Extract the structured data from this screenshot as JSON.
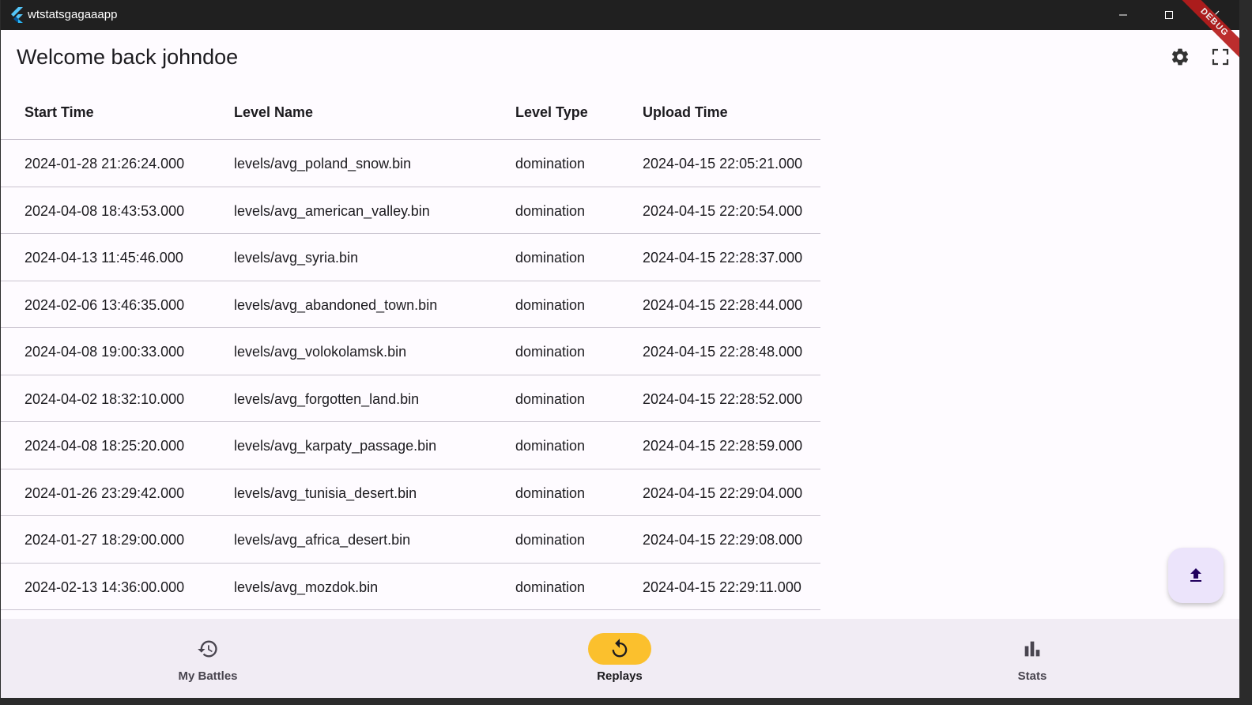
{
  "window": {
    "title": "wtstatsgagaaapp"
  },
  "header": {
    "welcome": "Welcome back johndoe",
    "debug_banner": "DEBUG"
  },
  "table": {
    "columns": [
      "Start Time",
      "Level Name",
      "Level Type",
      "Upload Time"
    ],
    "rows": [
      [
        "2024-01-28 21:26:24.000",
        "levels/avg_poland_snow.bin",
        "domination",
        "2024-04-15 22:05:21.000"
      ],
      [
        "2024-04-08 18:43:53.000",
        "levels/avg_american_valley.bin",
        "domination",
        "2024-04-15 22:20:54.000"
      ],
      [
        "2024-04-13 11:45:46.000",
        "levels/avg_syria.bin",
        "domination",
        "2024-04-15 22:28:37.000"
      ],
      [
        "2024-02-06 13:46:35.000",
        "levels/avg_abandoned_town.bin",
        "domination",
        "2024-04-15 22:28:44.000"
      ],
      [
        "2024-04-08 19:00:33.000",
        "levels/avg_volokolamsk.bin",
        "domination",
        "2024-04-15 22:28:48.000"
      ],
      [
        "2024-04-02 18:32:10.000",
        "levels/avg_forgotten_land.bin",
        "domination",
        "2024-04-15 22:28:52.000"
      ],
      [
        "2024-04-08 18:25:20.000",
        "levels/avg_karpaty_passage.bin",
        "domination",
        "2024-04-15 22:28:59.000"
      ],
      [
        "2024-01-26 23:29:42.000",
        "levels/avg_tunisia_desert.bin",
        "domination",
        "2024-04-15 22:29:04.000"
      ],
      [
        "2024-01-27 18:29:00.000",
        "levels/avg_africa_desert.bin",
        "domination",
        "2024-04-15 22:29:08.000"
      ],
      [
        "2024-02-13 14:36:00.000",
        "levels/avg_mozdok.bin",
        "domination",
        "2024-04-15 22:29:11.000"
      ]
    ]
  },
  "fab": {
    "icon": "upload-icon"
  },
  "nav": {
    "items": [
      {
        "label": "My Battles",
        "icon": "history-icon",
        "active": false
      },
      {
        "label": "Replays",
        "icon": "replay-icon",
        "active": true
      },
      {
        "label": "Stats",
        "icon": "bar-chart-icon",
        "active": false
      }
    ]
  },
  "colors": {
    "accent": "#fbc02d",
    "fab_bg": "#ece4fb",
    "nav_bg": "#f1ecf4",
    "titlebar": "#202020",
    "debug": "#b71c1c"
  }
}
